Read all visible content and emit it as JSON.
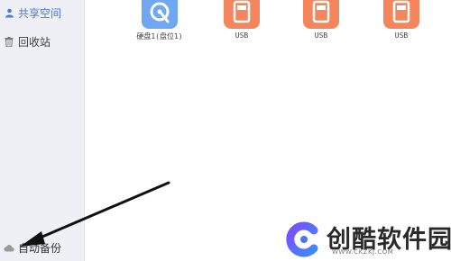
{
  "sidebar": {
    "items": [
      {
        "label": "共享空间",
        "icon": "share-space-icon",
        "active": true
      },
      {
        "label": "回收站",
        "icon": "trash-icon"
      },
      {
        "label": "自动备份",
        "icon": "cloud-icon"
      }
    ]
  },
  "drives": [
    {
      "label": "硬盘1(盘位1)",
      "type": "hdd",
      "icon": "hard-disk-icon",
      "color": "#6fa7f3"
    },
    {
      "label": "USB",
      "type": "usb",
      "icon": "usb-drive-icon",
      "color": "#f5855d"
    },
    {
      "label": "USB",
      "type": "usb",
      "icon": "usb-drive-icon",
      "color": "#f5855d"
    },
    {
      "label": "USB",
      "type": "usb",
      "icon": "usb-drive-icon",
      "color": "#f5855d"
    }
  ],
  "watermark": {
    "text": "创酷软件园",
    "url": "WWW.CKZKJ.COM",
    "logo": "c-logo-icon"
  },
  "colors": {
    "accent": "#4a78ea",
    "sidebar_bg": "#eef0f6"
  }
}
